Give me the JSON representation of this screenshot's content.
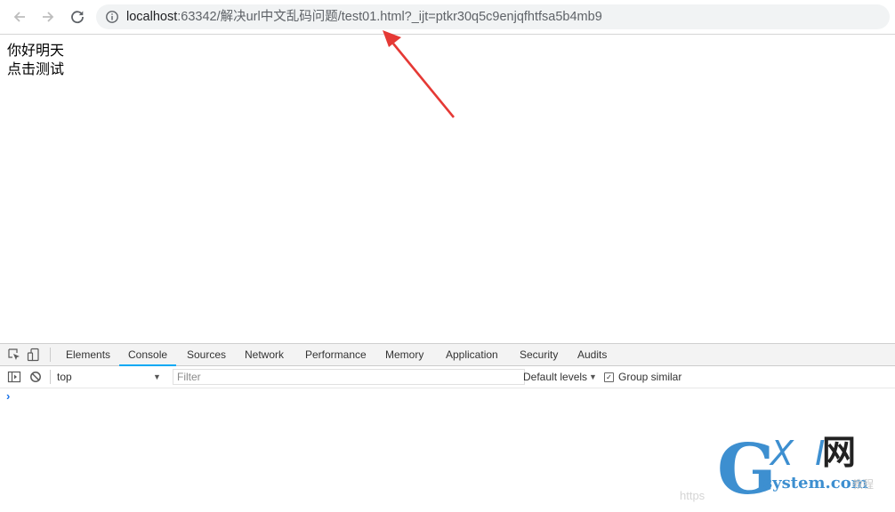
{
  "browser": {
    "back_icon": "arrow-left-icon",
    "forward_icon": "arrow-right-icon",
    "reload_icon": "reload-icon",
    "info_icon": "info-icon",
    "url_host": "localhost",
    "url_rest": ":63342/解决url中文乱码问题/test01.html?_ijt=ptkr30q5c9enjqfhtfsa5b4mb9"
  },
  "page": {
    "line1": "你好明天",
    "line2": "点击测试"
  },
  "annotation": {
    "arrow_color": "#e53935"
  },
  "devtools": {
    "inspect_icon": "inspect-element-icon",
    "device_icon": "device-toolbar-icon",
    "tabs": [
      {
        "label": "Elements",
        "active": false
      },
      {
        "label": "Console",
        "active": true
      },
      {
        "label": "Sources",
        "active": false
      },
      {
        "label": "Network",
        "active": false
      },
      {
        "label": "Performance",
        "active": false
      },
      {
        "label": "Memory",
        "active": false
      },
      {
        "label": "Application",
        "active": false
      },
      {
        "label": "Security",
        "active": false
      },
      {
        "label": "Audits",
        "active": false
      }
    ],
    "active_tab_color": "#03a9f4",
    "console": {
      "sidebar_icon": "sidebar-toggle-icon",
      "clear_icon": "clear-console-icon",
      "context": "top",
      "filter_placeholder": "Filter",
      "levels": "Default levels",
      "group_similar_label": "Group similar",
      "group_similar_checked": true,
      "prompt": "›"
    }
  },
  "watermark": {
    "g": "G",
    "xi": "X I",
    "wang": "网",
    "system": "system.com",
    "faint_left": "https",
    "faint_right": "教程"
  }
}
